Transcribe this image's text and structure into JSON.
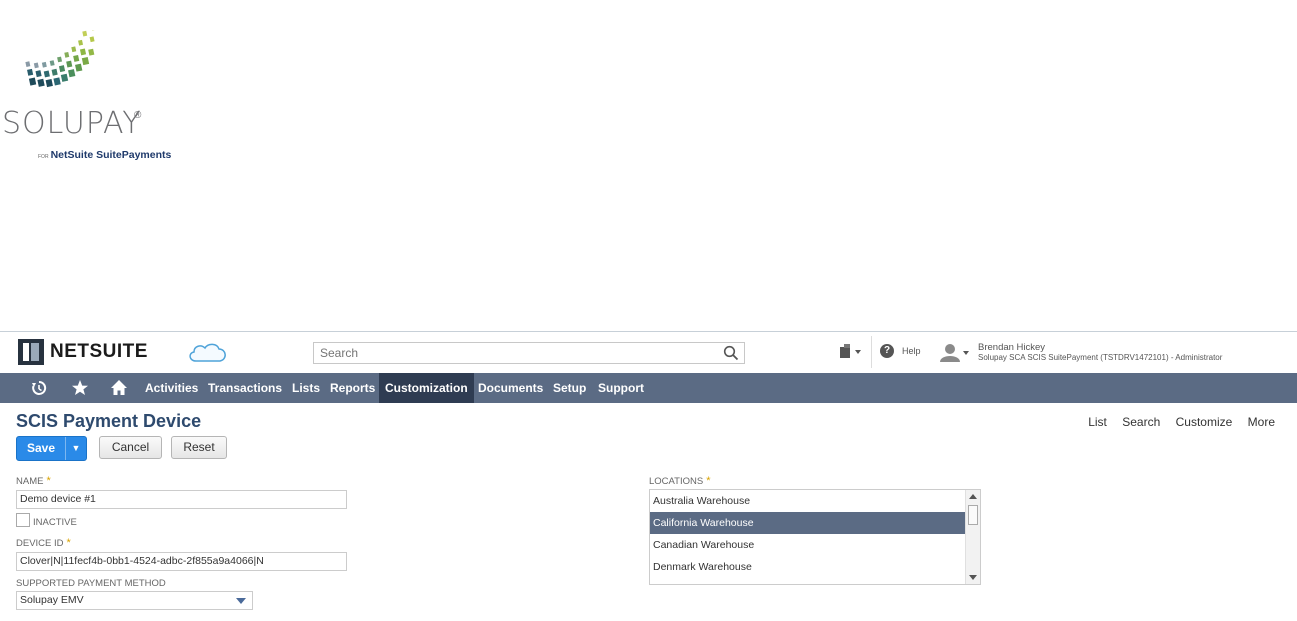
{
  "brand": {
    "logo_word": "SOLUPAY",
    "logo_reg": "®",
    "logo_tag_prefix": "FOR",
    "logo_tag": "NetSuite SuitePayments"
  },
  "header": {
    "app_name": "NETSUITE",
    "search_placeholder": "Search",
    "help_label": "Help",
    "user_name": "Brendan Hickey",
    "user_role": "Solupay SCA SCIS SuitePayment (TSTDRV1472101) - Administrator"
  },
  "nav": {
    "items": [
      {
        "label": "Activities"
      },
      {
        "label": "Transactions"
      },
      {
        "label": "Lists"
      },
      {
        "label": "Reports"
      },
      {
        "label": "Customization"
      },
      {
        "label": "Documents"
      },
      {
        "label": "Setup"
      },
      {
        "label": "Support"
      }
    ],
    "active": "Customization"
  },
  "page": {
    "title": "SCIS Payment Device",
    "links": [
      "List",
      "Search",
      "Customize",
      "More"
    ]
  },
  "buttons": {
    "save": "Save",
    "save_arrow": "▼",
    "cancel": "Cancel",
    "reset": "Reset"
  },
  "form": {
    "name_label": "NAME",
    "name_value": "Demo device #1",
    "inactive_label": "INACTIVE",
    "inactive_checked": false,
    "device_id_label": "DEVICE ID",
    "device_id_value": "Clover|N|11fecf4b-0bb1-4524-adbc-2f855a9a4066|N",
    "payment_method_label": "SUPPORTED PAYMENT METHOD",
    "payment_method_value": "Solupay EMV",
    "locations_label": "LOCATIONS",
    "required_mark": "*",
    "locations": [
      {
        "label": "Australia Warehouse",
        "selected": false
      },
      {
        "label": "California Warehouse",
        "selected": true
      },
      {
        "label": "Canadian Warehouse",
        "selected": false
      },
      {
        "label": "Denmark Warehouse",
        "selected": false
      }
    ]
  },
  "colors": {
    "nav_bg": "#5b6b84",
    "nav_active": "#2f3c52",
    "title": "#2e4a6e",
    "primary_button": "#2a8ae8",
    "required": "#d9a300"
  }
}
